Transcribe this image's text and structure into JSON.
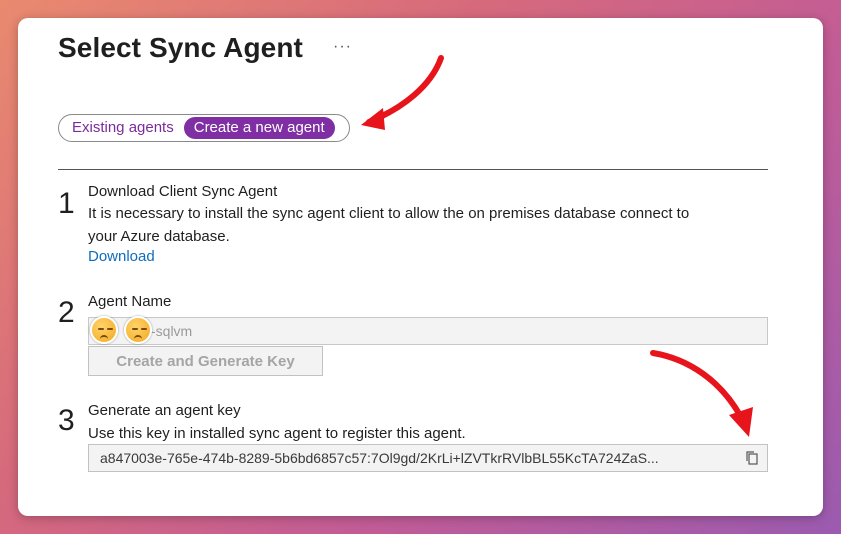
{
  "header": {
    "title": "Select Sync Agent",
    "more_label": "···"
  },
  "agent_toggle": {
    "options": [
      {
        "label": "Existing agents",
        "selected": false
      },
      {
        "label": "Create a new agent",
        "selected": true
      }
    ]
  },
  "steps": [
    {
      "number": "1",
      "title": "Download Client Sync Agent",
      "description_line1": "It is necessary to install the sync agent client to allow the on premises database connect to",
      "description_line2": "your Azure database.",
      "link_label": "Download"
    },
    {
      "number": "2",
      "title": "Agent Name",
      "input_value": "-sqlvm",
      "button_label": "Create and Generate Key"
    },
    {
      "number": "3",
      "title": "Generate an agent key",
      "description": "Use this key in installed sync agent to register this agent.",
      "key_value": "a847003e-765e-474b-8289-5b6bd6857c57:7Ol9gd/2KrLi+lZVTkrRVlbBL55KcTA724ZaS..."
    }
  ],
  "colors": {
    "accent": "#7f2ea3",
    "link": "#0f6cbd",
    "annotation_arrow": "#e8141b"
  },
  "icons": [
    "more-icon",
    "copy-icon",
    "annotation-arrow",
    "redaction-emoji"
  ]
}
